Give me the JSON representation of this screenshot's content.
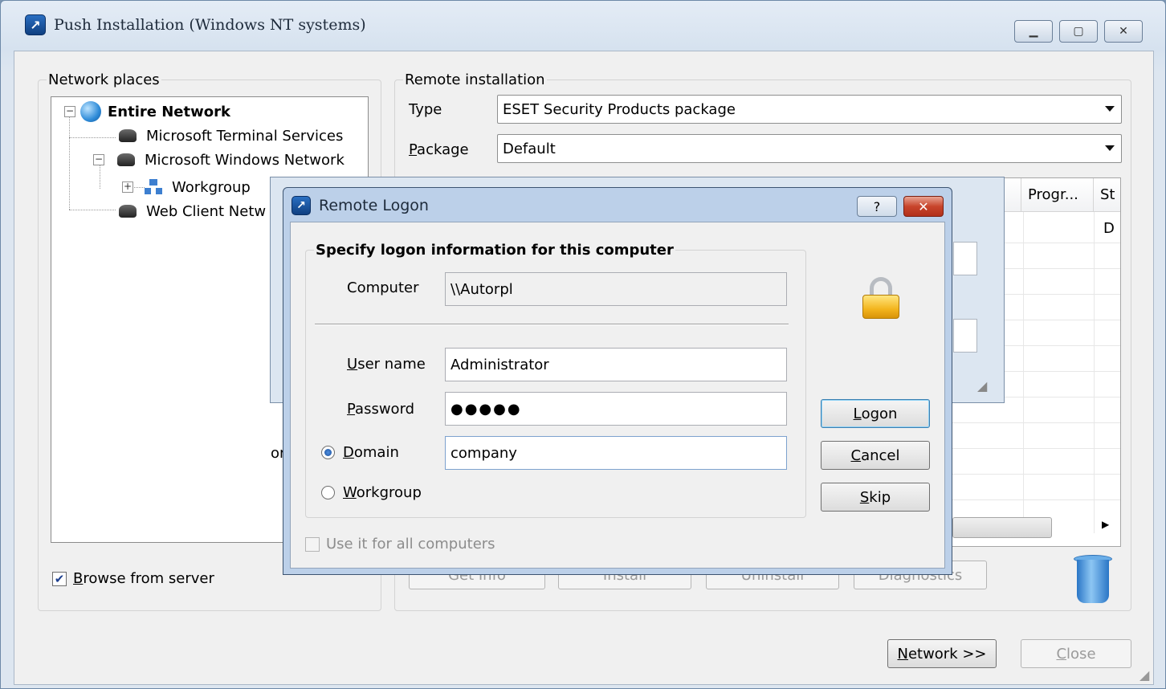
{
  "main": {
    "title": "Push Installation (Windows NT systems)",
    "buttons": {
      "network": "Network >>",
      "close": "Close"
    }
  },
  "network_places": {
    "legend": "Network places",
    "tree": [
      "Entire Network",
      "Microsoft Terminal Services",
      "Microsoft Windows Network",
      "Workgroup",
      "Web Client Netw"
    ],
    "browse_from_server": {
      "label": "Browse from server",
      "checked": true
    },
    "partial_text": "or"
  },
  "remote_installation": {
    "legend": "Remote installation",
    "type_label": "Type",
    "type_value": "ESET Security Products package",
    "package_label": "Package",
    "package_value": "Default",
    "grid_headers": [
      ".",
      "Progr...",
      "St"
    ],
    "grid_first_row": [
      "D"
    ],
    "action_buttons": [
      "Get Info",
      "Install",
      "Uninstall",
      "Diagnostics"
    ]
  },
  "logon_dialog": {
    "title": "Remote Logon",
    "help": "?",
    "group_legend": "Specify logon information for this computer",
    "computer_label": "Computer",
    "computer_value": "\\\\Autorpl",
    "username_label": "User name",
    "username_value": "Administrator",
    "password_label": "Password",
    "password_value": "●●●●●",
    "domain_label": "Domain",
    "domain_value": "company",
    "workgroup_label": "Workgroup",
    "selected_option": "Domain",
    "use_for_all_label": "Use it for all computers",
    "buttons": {
      "logon": "Logon",
      "cancel": "Cancel",
      "skip": "Skip"
    }
  }
}
